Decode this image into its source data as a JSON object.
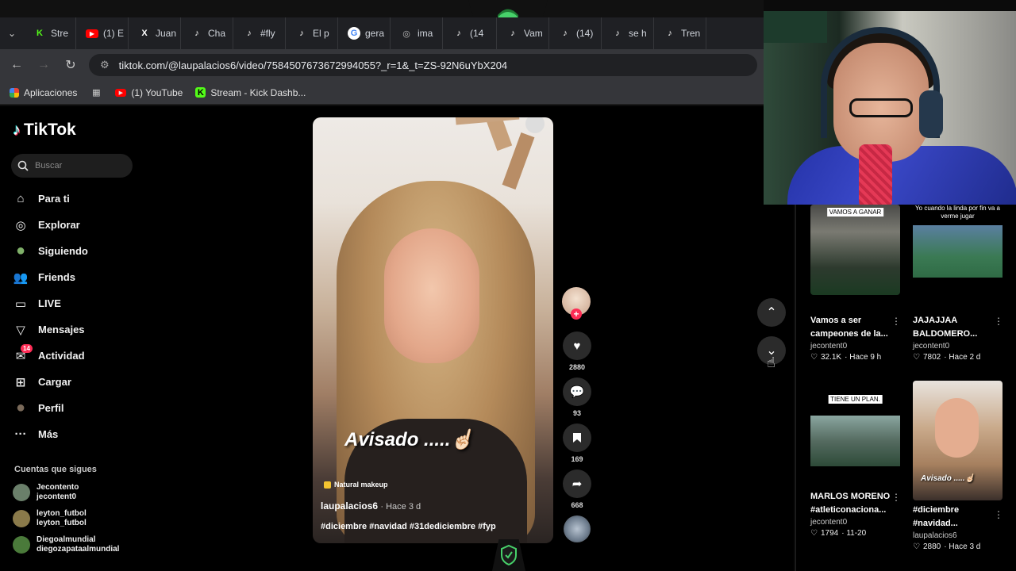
{
  "browser": {
    "tabs": [
      {
        "label": "Stre",
        "icon": "kick-icon",
        "color": "#53fc18"
      },
      {
        "label": "(1) E",
        "icon": "youtube-icon",
        "color": "#ff0000"
      },
      {
        "label": "Juan",
        "icon": "x-icon",
        "color": "#ffffff"
      },
      {
        "label": "Cha",
        "icon": "tiktok-icon",
        "color": "#ffffff"
      },
      {
        "label": "#fly",
        "icon": "tiktok-icon",
        "color": "#ffffff"
      },
      {
        "label": "El p",
        "icon": "tiktok-icon",
        "color": "#ffffff"
      },
      {
        "label": "gera",
        "icon": "google-icon",
        "color": "#4285f4"
      },
      {
        "label": "ima",
        "icon": "globe-icon",
        "color": "#bbbbbb"
      },
      {
        "label": "(14",
        "icon": "tiktok-icon",
        "color": "#ffffff"
      },
      {
        "label": "Vam",
        "icon": "tiktok-icon",
        "color": "#ffffff"
      },
      {
        "label": "(14)",
        "icon": "tiktok-icon",
        "color": "#ffffff"
      },
      {
        "label": "se h",
        "icon": "tiktok-icon",
        "color": "#ffffff"
      },
      {
        "label": "Tren",
        "icon": "tiktok-icon",
        "color": "#ffffff"
      }
    ],
    "url": "tiktok.com/@laupalacios6/video/7584507673672994055?_r=1&_t=ZS-92N6uYbX204",
    "bookmarks": [
      {
        "label": "Aplicaciones",
        "icon": "apps-grid-icon"
      },
      {
        "label": "",
        "icon": "grid-icon"
      },
      {
        "label": "(1) YouTube",
        "icon": "youtube-icon"
      },
      {
        "label": "Stream - Kick Dashb...",
        "icon": "kick-icon"
      }
    ]
  },
  "tiktok": {
    "logo": "TikTok",
    "search_placeholder": "Buscar",
    "nav": [
      {
        "label": "Para ti",
        "icon": "home-icon"
      },
      {
        "label": "Explorar",
        "icon": "compass-icon"
      },
      {
        "label": "Siguiendo",
        "icon": "following-avatar-icon"
      },
      {
        "label": "Friends",
        "icon": "friends-icon"
      },
      {
        "label": "LIVE",
        "icon": "live-icon"
      },
      {
        "label": "Mensajes",
        "icon": "messages-icon"
      },
      {
        "label": "Actividad",
        "icon": "activity-icon",
        "badge": "14"
      },
      {
        "label": "Cargar",
        "icon": "upload-icon"
      },
      {
        "label": "Perfil",
        "icon": "profile-icon"
      },
      {
        "label": "Más",
        "icon": "more-icon"
      }
    ],
    "following_title": "Cuentas que sigues",
    "following": [
      {
        "name": "Jecontento",
        "handle": "jecontent0"
      },
      {
        "name": "leyton_futbol",
        "handle": "leyton_futbol"
      },
      {
        "name": "Diegoalmundial",
        "handle": "diegozapataalmundial"
      }
    ],
    "video": {
      "overlay_text": "Avisado .....☝🏻",
      "tag": "Natural makeup",
      "author": "laupalacios6",
      "time": "· Hace 3 d",
      "hashtags": "#diciembre #navidad #31dediciembre #fyp"
    },
    "actions": {
      "likes": "2880",
      "comments": "93",
      "saves": "169",
      "shares": "668"
    },
    "related": [
      {
        "label": "VAMOS A GANAR",
        "title": "Vamos a ser campeones de la...",
        "author": "jecontent0",
        "likes": "32.1K",
        "time": "· Hace 9 h"
      },
      {
        "label": "Yo cuando la linda por fin va a verme jugar",
        "title": "JAJAJJAA BALDOMERO...",
        "author": "jecontent0",
        "likes": "7802",
        "time": "· Hace 2 d"
      },
      {
        "label": "TIENE UN PLAN.",
        "title": "MARLOS MORENO #atleticonaciona...",
        "author": "jecontent0",
        "likes": "1794",
        "time": "· 11-20"
      },
      {
        "label": "Avisado .....☝🏻",
        "title": "#diciembre #navidad...",
        "author": "laupalacios6",
        "likes": "2880",
        "time": "· Hace 3 d"
      }
    ]
  },
  "colors": {
    "accent": "#fe2c55",
    "kick": "#53fc18"
  }
}
